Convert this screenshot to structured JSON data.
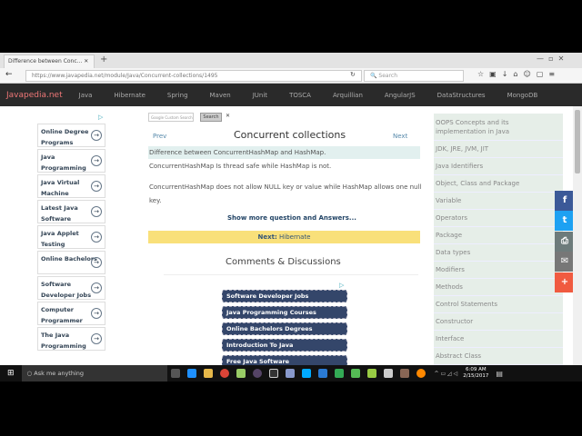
{
  "browser": {
    "tab_title": "Difference between Conc...",
    "url": "https://www.javapedia.net/module/Java/Concurrent-collections/1495",
    "search_placeholder": "Search"
  },
  "nav": {
    "brand": "Javapedia.net",
    "items": [
      "Java",
      "Hibernate",
      "Spring",
      "Maven",
      "JUnit",
      "TOSCA",
      "Arquillian",
      "AngularJS",
      "DataStructures",
      "MongoDB"
    ]
  },
  "left_ads": [
    "Online Degree Programs",
    "Java Programming",
    "Java Virtual Machine",
    "Latest Java Software",
    "Java Applet Testing",
    "Online Bachelors",
    "Software Developer Jobs",
    "Computer Programmer",
    "The Java Programming"
  ],
  "main": {
    "google_search_placeholder": "Google Custom Search",
    "search_button": "Search",
    "prev": "Prev",
    "title": "Concurrent collections",
    "next": "Next",
    "question": "Difference between ConcurrentHashMap and HashMap.",
    "answer1": "ConcurrentHashMap Is thread safe while HashMap is not.",
    "answer2": "ConcurrentHashMap does not allow NULL key or value while HashMap allows one null key.",
    "show_more": "Show more question and Answers...",
    "next_label": "Next:",
    "next_topic": "Hibernate",
    "comments_title": "Comments & Discussions",
    "ad_buttons": [
      "Software Developer Jobs",
      "Java Programming Courses",
      "Online Bachelors Degrees",
      "Introduction To Java",
      "Free Java Software"
    ]
  },
  "right_menu": [
    "OOPS Concepts and its implementation in Java",
    "JDK, JRE, JVM, JIT",
    "Java Identifiers",
    "Object, Class and Package",
    "Variable",
    "Operators",
    "Package",
    "Data types",
    "Modifiers",
    "Methods",
    "Control Statements",
    "Constructor",
    "Interface",
    "Abstract Class"
  ],
  "taskbar": {
    "cortana": "Ask me anything",
    "time": "6:09 AM",
    "date": "2/15/2017"
  }
}
